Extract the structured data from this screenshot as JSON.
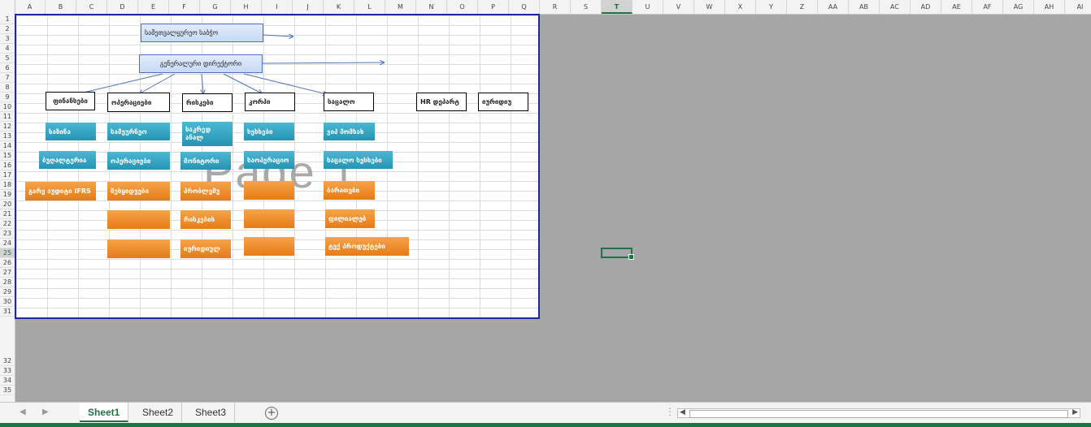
{
  "columns": [
    "A",
    "B",
    "C",
    "D",
    "E",
    "F",
    "G",
    "H",
    "I",
    "J",
    "K",
    "L",
    "M",
    "N",
    "O",
    "P",
    "Q",
    "R",
    "S",
    "T",
    "U",
    "V",
    "W",
    "X",
    "Y",
    "Z",
    "AA",
    "AB",
    "AC",
    "AD",
    "AE",
    "AF",
    "AG",
    "AH",
    "AI"
  ],
  "selected_column": "T",
  "rows": [
    "1",
    "2",
    "3",
    "4",
    "5",
    "6",
    "7",
    "8",
    "9",
    "10",
    "11",
    "12",
    "13",
    "14",
    "15",
    "16",
    "17",
    "18",
    "19",
    "20",
    "21",
    "22",
    "23",
    "24",
    "25",
    "26",
    "27",
    "28",
    "29",
    "30",
    "31",
    "32",
    "33",
    "34",
    "35"
  ],
  "selected_row": "25",
  "watermark": "Page 1",
  "org": {
    "board": "სამეთვალყურეო საბჭო",
    "ceo": "გენერალური დირექტორი",
    "departments": {
      "finance": "ფინანსები",
      "operations": "ოპერაციები",
      "risks": "რისკები",
      "corp": "კორპი",
      "retail": "საცალო",
      "hr": "HR დეპარტ",
      "legal": "იურიდიუ"
    },
    "finance_units": [
      "ხაზინა",
      "ბუღალტერია",
      "გარე აუდიტი IFRS"
    ],
    "operations_units": [
      "სამეურნეო",
      "ოპერაციები",
      "შესყიდვები",
      "",
      ""
    ],
    "risks_units": [
      "საკრედ ანალ",
      "მონიტორი",
      "პრობლემუ",
      "რისკების",
      "იურიდიულ"
    ],
    "corp_units": [
      "სესხები",
      "საოპერაციო",
      "",
      "",
      ""
    ],
    "retail_units": [
      "ვიპ მომსახ",
      "საცალო სესხები",
      "ბარათები",
      "ფილიალებ",
      "ტექ პროდუქტები"
    ]
  },
  "sheets": {
    "tabs": [
      "Sheet1",
      "Sheet2",
      "Sheet3"
    ],
    "active": "Sheet1"
  }
}
